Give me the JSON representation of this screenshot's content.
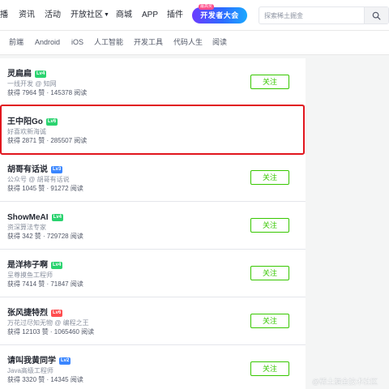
{
  "topnav": {
    "items": [
      "播",
      "资讯",
      "活动",
      "开放社区",
      "商城",
      "APP",
      "插件"
    ],
    "promo": {
      "tag": "最高奖",
      "label": "开发者大会"
    },
    "search": {
      "placeholder": "探索稀土掘金"
    }
  },
  "subnav": {
    "tags": [
      "前端",
      "Android",
      "iOS",
      "人工智能",
      "开发工具",
      "代码人生",
      "阅读"
    ]
  },
  "authors": [
    {
      "name": "灵扁扁",
      "level": "Lv4",
      "level_color": "#2ad36f",
      "desc": "一线开发 @ 知网",
      "stats": "获得 7964 赞 · 145378 阅读",
      "follow": "关注"
    },
    {
      "name": "王中阳Go",
      "level": "Lv6",
      "level_color": "#2ad36f",
      "desc": "好喜欢新海诚",
      "stats": "获得 2871 赞 · 285507 阅读",
      "follow": ""
    },
    {
      "name": "胡哥有话说",
      "level": "Lv3",
      "level_color": "#3a86ff",
      "desc": "公众号 @ 胡哥有话说",
      "stats": "获得 1045 赞 · 91272 阅读",
      "follow": "关注"
    },
    {
      "name": "ShowMeAI",
      "level": "Lv4",
      "level_color": "#2ad36f",
      "desc": "资深算法专家",
      "stats": "获得 342 赞 · 729728 阅读",
      "follow": "关注"
    },
    {
      "name": "是洋柿子啊",
      "level": "Lv4",
      "level_color": "#2ad36f",
      "desc": "呈尊摸鱼工程师",
      "stats": "获得 7414 赞 · 71847 阅读",
      "follow": "关注"
    },
    {
      "name": "张风捷特烈",
      "level": "Lv6",
      "level_color": "#ff4d4f",
      "desc": "万花过尽知无物 @ 编程之王",
      "stats": "获得 12103 赞 · 1065460 阅读",
      "follow": "关注"
    },
    {
      "name": "请叫我黄同学",
      "level": "Lv2",
      "level_color": "#3a86ff",
      "desc": "Java高级工程师",
      "stats": "获得 3320 赞 · 14345 阅读",
      "follow": "关注"
    }
  ],
  "watermark": "@稀土掘金技术社区"
}
